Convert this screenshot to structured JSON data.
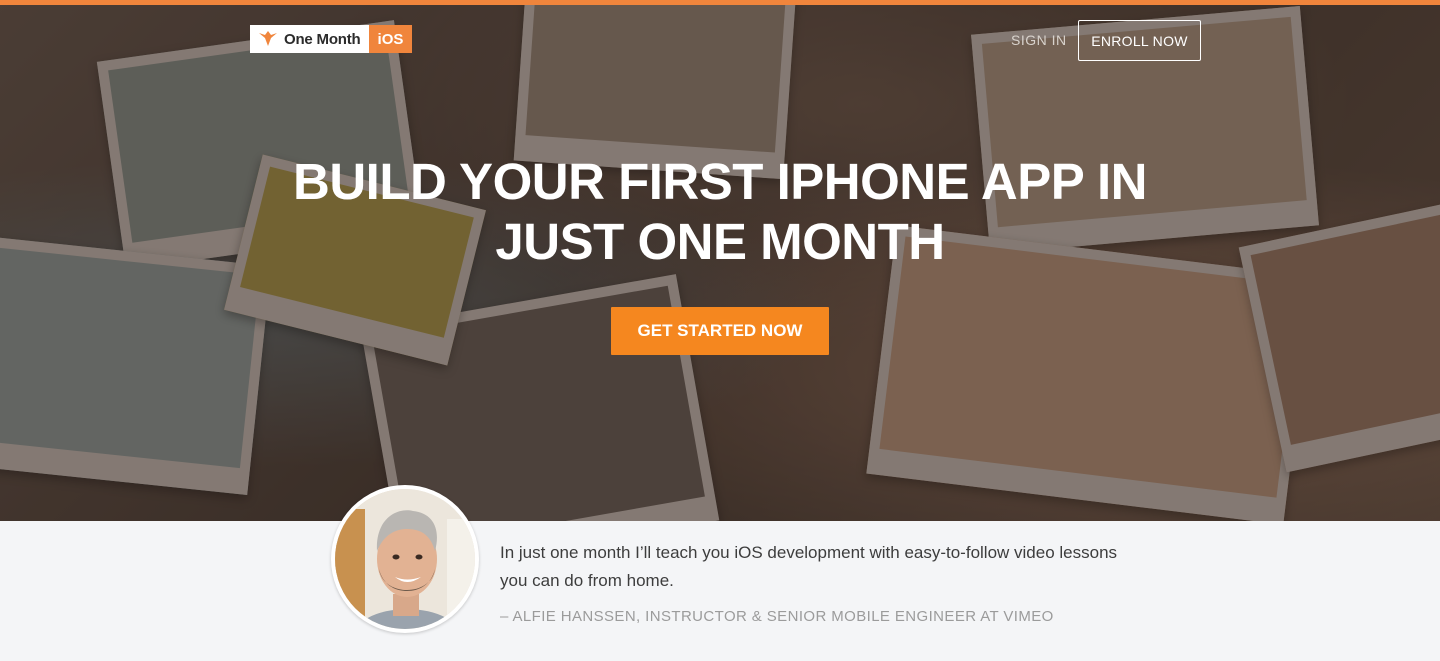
{
  "nav": {
    "logo_text": "One Month",
    "logo_badge": "iOS",
    "sign_in": "SIGN IN",
    "enroll": "ENROLL NOW"
  },
  "hero": {
    "headline_line1": "BUILD YOUR FIRST IPHONE APP IN",
    "headline_line2": "JUST ONE MONTH",
    "cta": "GET STARTED NOW"
  },
  "testimonial": {
    "quote": "In just one month I’ll teach you iOS development with easy-to-follow video lessons you can do from home.",
    "attribution": "– ALFIE HANSSEN, INSTRUCTOR & SENIOR MOBILE ENGINEER AT VIMEO"
  },
  "colors": {
    "accent": "#f5871f",
    "top_strip": "#f0853c"
  },
  "icons": {
    "logo": "bird-logo-icon"
  }
}
